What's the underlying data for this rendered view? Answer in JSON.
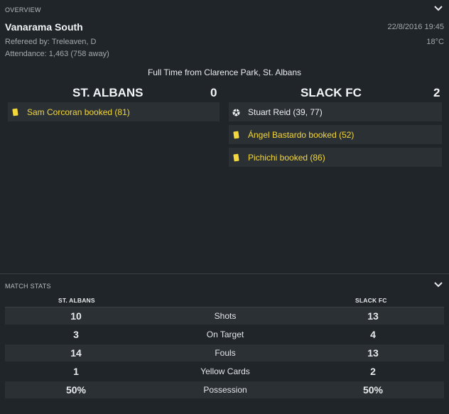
{
  "overview": {
    "section_title": "OVERVIEW",
    "competition": "Vanarama South",
    "referee": "Refereed by: Treleaven, D",
    "attendance": "Attendance: 1,463 (758 away)",
    "datetime": "22/8/2016 19:45",
    "temperature": "18°C",
    "result_line": "Full Time from Clarence Park, St. Albans",
    "home": {
      "name": "ST. ALBANS",
      "score": "0",
      "events": [
        {
          "type": "booking",
          "icon": "yellow-card-icon",
          "text": "Sam Corcoran booked (81)"
        }
      ]
    },
    "away": {
      "name": "SLACK FC",
      "score": "2",
      "events": [
        {
          "type": "goal",
          "icon": "football-icon",
          "text": "Stuart Reid (39, 77)"
        },
        {
          "type": "booking",
          "icon": "yellow-card-icon",
          "text": "Ángel Bastardo booked (52)"
        },
        {
          "type": "booking",
          "icon": "yellow-card-icon",
          "text": "Pichichi booked (86)"
        }
      ]
    }
  },
  "stats": {
    "section_title": "MATCH STATS",
    "home_label": "ST. ALBANS",
    "away_label": "SLACK FC",
    "rows": [
      {
        "label": "Shots",
        "home": "10",
        "away": "13"
      },
      {
        "label": "On Target",
        "home": "3",
        "away": "4"
      },
      {
        "label": "Fouls",
        "home": "14",
        "away": "13"
      },
      {
        "label": "Yellow Cards",
        "home": "1",
        "away": "2"
      },
      {
        "label": "Possession",
        "home": "50%",
        "away": "50%"
      }
    ]
  },
  "colors": {
    "background": "#20252a",
    "row_alt": "#2b3035",
    "booking_yellow": "#f4d83b"
  }
}
